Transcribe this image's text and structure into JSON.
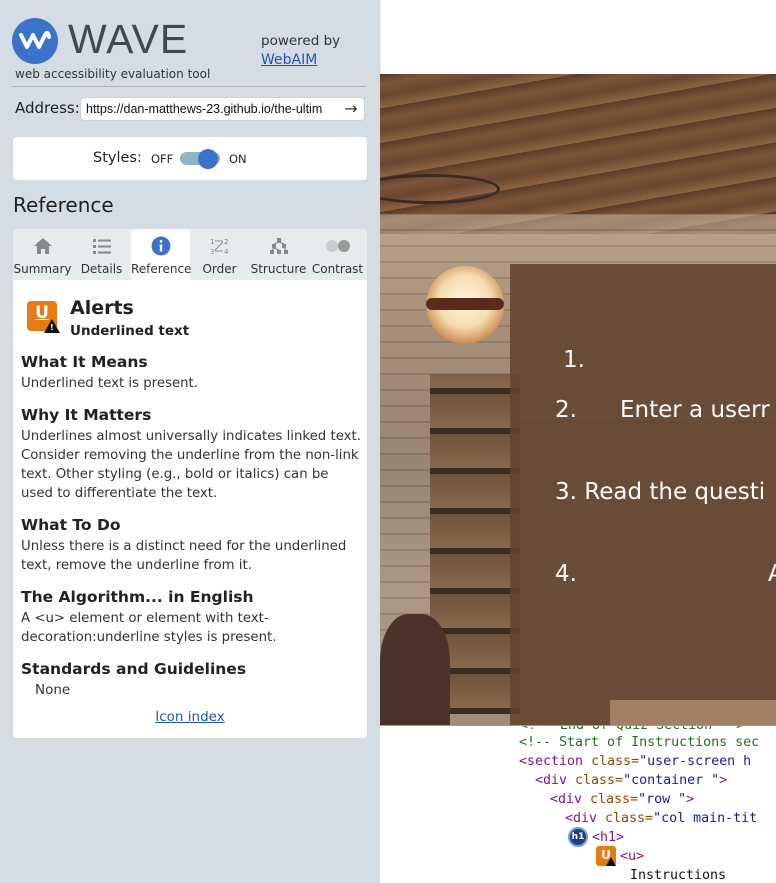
{
  "wave": {
    "logo_text": "WAVE",
    "tagline": "web accessibility evaluation tool",
    "powered_by": "powered by",
    "webaim_link": "WebAIM",
    "address_label": "Address:",
    "address_value": "https://dan-matthews-23.github.io/the-ultim",
    "styles_label": "Styles:",
    "styles_off": "OFF",
    "styles_on": "ON",
    "styles_state": "on",
    "panel_heading": "Reference",
    "tabs": [
      {
        "label": "Summary",
        "icon": "home-icon"
      },
      {
        "label": "Details",
        "icon": "list-icon"
      },
      {
        "label": "Reference",
        "icon": "info-icon",
        "active": true
      },
      {
        "label": "Order",
        "icon": "order-icon"
      },
      {
        "label": "Structure",
        "icon": "structure-icon"
      },
      {
        "label": "Contrast",
        "icon": "contrast-icon"
      }
    ],
    "reference": {
      "category": "Alerts",
      "item_name": "Underlined text",
      "icon_letter": "U",
      "what_it_means_h": "What It Means",
      "what_it_means": "Underlined text is present.",
      "why_it_matters_h": "Why It Matters",
      "why_it_matters": "Underlines almost universally indicates linked text. Consider removing the underline from the non-link text. Other styling (e.g., bold or italics) can be used to differentiate the text.",
      "what_to_do_h": "What To Do",
      "what_to_do": "Unless there is a distinct need for the underlined text, remove the underline from it.",
      "algorithm_h": "The Algorithm... in English",
      "algorithm": "A <u> element or element with text-decoration:underline styles is present.",
      "standards_h": "Standards and Guidelines",
      "standards": "None",
      "icon_index": "Icon index"
    },
    "colors": {
      "accent": "#3a73c9",
      "alert": "#e57b12",
      "sidebar": "#d4dde3"
    }
  },
  "page": {
    "instructions": [
      "1.",
      "2.",
      "Enter a userr",
      "3. Read the questi",
      "4.",
      "A"
    ]
  },
  "code": {
    "line0": "<!-- End of Quiz Section -->",
    "line1": "<!-- Start of Instructions sec",
    "line2_tag": "<section ",
    "line2_attr": "class=",
    "line2_val": "\"user-screen h",
    "line3_tag": "<div ",
    "line3_attr": "class=",
    "line3_val": "\"container \"",
    "line3_end": ">",
    "line4_tag": "<div ",
    "line4_attr": "class=",
    "line4_val": "\"row \"",
    "line4_end": ">",
    "line5_tag": "<div ",
    "line5_attr": "class=",
    "line5_val": "\"col main-tit",
    "line6_tag": "<h1>",
    "line7_tag": "<u>",
    "line8_text": "Instructions",
    "h1_badge": "h1",
    "u_badge": "U"
  }
}
